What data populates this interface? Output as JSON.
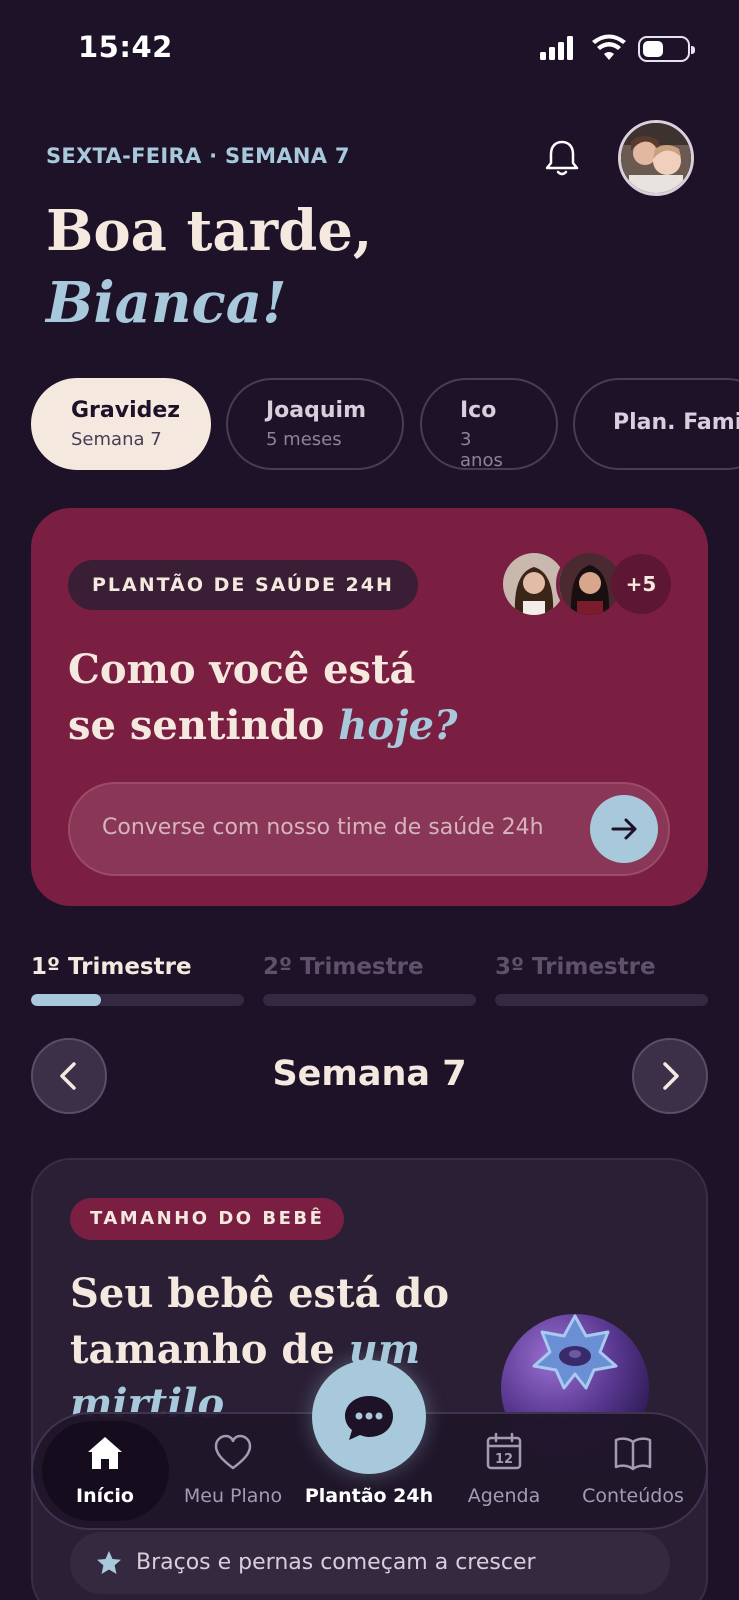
{
  "status_bar": {
    "time": "15:42"
  },
  "header": {
    "date_line": "SEXTA-FEIRA · SEMANA 7",
    "greeting": "Boa tarde,",
    "name": "Bianca!"
  },
  "profiles": [
    {
      "name": "Gravidez",
      "sub": "Semana 7",
      "active": true
    },
    {
      "name": "Joaquim",
      "sub": "5 meses",
      "active": false
    },
    {
      "name": "Ico",
      "sub": "3 anos",
      "active": false
    },
    {
      "name": "Plan. Famili",
      "sub": "",
      "active": false
    }
  ],
  "health_card": {
    "pill": "PLANTÃO DE SAÚDE 24H",
    "more_count": "+5",
    "question_line1": "Como você está",
    "question_line2": "se sentindo ",
    "question_emph": "hoje?",
    "input_placeholder": "Converse com nosso time de saúde 24h"
  },
  "trimesters": [
    {
      "label": "1º Trimestre",
      "active": true,
      "progress": 0.33
    },
    {
      "label": "2º Trimestre",
      "active": false,
      "progress": 0
    },
    {
      "label": "3º Trimestre",
      "active": false,
      "progress": 0
    }
  ],
  "week_nav": {
    "title": "Semana 7"
  },
  "baby_card": {
    "pill": "TAMANHO DO BEBÊ",
    "line1": "Seu bebê está do",
    "line2": "tamanho de ",
    "line2_emph": "um",
    "line3": "mirtilo",
    "fruit_icon": "blueberry"
  },
  "milestone": {
    "text": "Braços e pernas começam a crescer"
  },
  "tabbar": {
    "items": [
      {
        "label": "Início",
        "icon": "home-icon",
        "active": true
      },
      {
        "label": "Meu Plano",
        "icon": "heart-icon",
        "active": false
      },
      {
        "label": "Plantão 24h",
        "icon": "chat-icon",
        "active": false
      },
      {
        "label": "Agenda",
        "icon": "calendar-icon",
        "active": false,
        "day": "12"
      },
      {
        "label": "Conteúdos",
        "icon": "book-icon",
        "active": false
      }
    ]
  },
  "colors": {
    "background": "#1d1228",
    "accent_blue": "#a8c9db",
    "wine": "#7b1f42",
    "cream": "#f5e9df"
  }
}
